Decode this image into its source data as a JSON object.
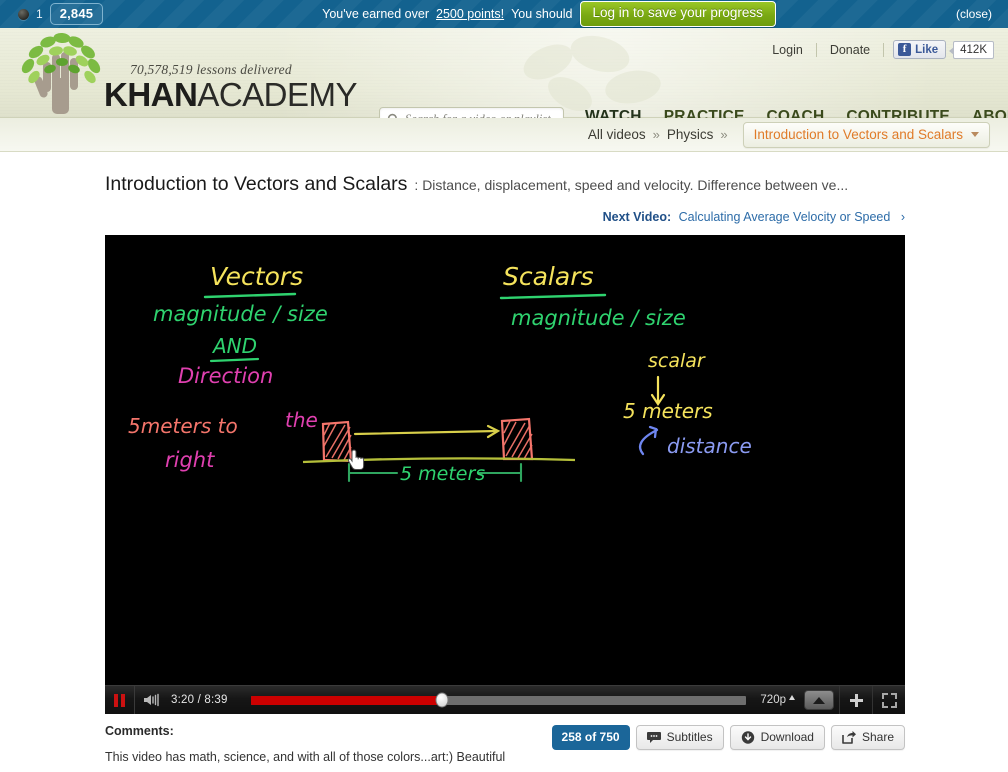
{
  "promo_banner": {
    "badge_icon": "badge-dot-icon",
    "badge_count": "1",
    "points": "2,845",
    "message_prefix": "You've earned over",
    "points_link": "2500 points!",
    "message_suffix": "You should",
    "login_button": "Log in to save your progress",
    "close_label": "(close)",
    "bg_color": "#13628f",
    "button_color": "#8ab91c"
  },
  "header": {
    "logo_tagline": "70,578,519 lessons delivered",
    "logo_khan": "KHAN",
    "logo_academy": "ACADEMY",
    "utility": {
      "login": "Login",
      "donate": "Donate",
      "fb_like_label": "Like",
      "fb_like_count": "412K"
    },
    "search": {
      "placeholder": "Search for a video or playlist",
      "value": ""
    },
    "nav": [
      {
        "label": "WATCH",
        "active": true
      },
      {
        "label": "PRACTICE",
        "active": false
      },
      {
        "label": "COACH",
        "active": false
      },
      {
        "label": "CONTRIBUTE",
        "active": false
      },
      {
        "label": "ABOUT",
        "active": false
      }
    ]
  },
  "breadcrumb": {
    "item1": "All videos",
    "sep1": "»",
    "item2": "Physics",
    "sep2": "»",
    "current_topic": "Introduction to Vectors and Scalars",
    "topic_color": "#e07b29"
  },
  "video_meta": {
    "title": "Introduction to Vectors and Scalars",
    "subtitle": ": Distance, displacement, speed and velocity. Difference between ve...",
    "next_video_label": "Next Video:",
    "next_video_title": "Calculating Average Velocity or Speed",
    "next_video_arrow": "›"
  },
  "player": {
    "pause_icon": "pause-icon",
    "volume_icon": "volume-icon",
    "current_time": "3:20",
    "total_time": "8:39",
    "time_display": "3:20 / 8:39",
    "progress_percent": 38.5,
    "quality": "720p",
    "expand_icon": "expand-up-icon",
    "plus_icon": "plus-icon",
    "fullscreen_icon": "fullscreen-icon",
    "progress_color": "#cc0000"
  },
  "chalkboard": {
    "heading_left": "Vectors",
    "left_line1": "magnitude / size",
    "left_line2": "AND",
    "left_line3": "Direction",
    "left_note_a": "5 meters to",
    "left_note_b": "the",
    "left_note_c": "right",
    "heading_right": "Scalars",
    "right_line1": "magnitude / size",
    "right_note1": "scalar",
    "right_note2": "5 meters",
    "right_note3": "distance",
    "measure_label": "5 meters",
    "colors": {
      "yellow": "#f5e35c",
      "green": "#2fd36f",
      "magenta": "#e040b0",
      "salmon": "#f4756b",
      "blue": "#6f86f0",
      "olive": "#b5bf3a"
    }
  },
  "footer": {
    "comments_label": "Comments:",
    "comment_text": "This video has math, science, and with all of those colors...art:) Beautiful",
    "counter": "258 of 750",
    "subtitles": "Subtitles",
    "download": "Download",
    "share": "Share",
    "counter_color": "#1b6699"
  }
}
